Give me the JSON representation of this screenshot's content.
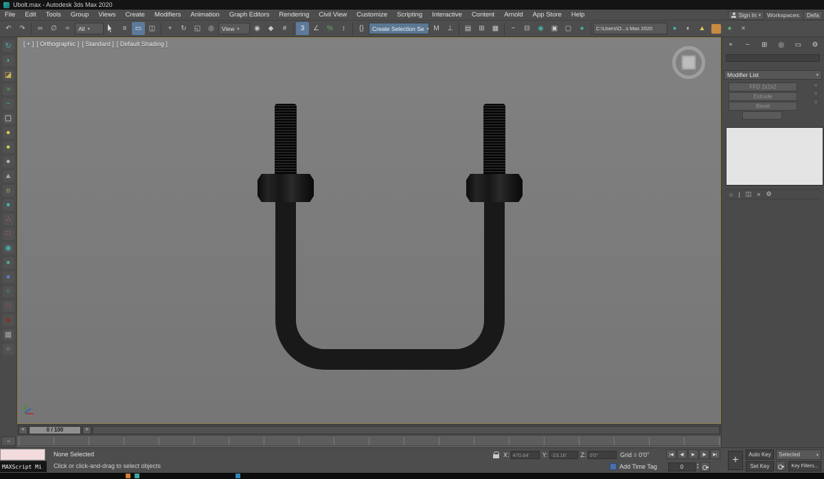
{
  "colors": {
    "accent_blue": "#5d7a9b",
    "panel_gray": "#4a4a4a",
    "viewport_bg": "#7c7c7c",
    "model_black": "#191919",
    "listener_pink": "#f2dadd",
    "viewport_border": "#8e7f44"
  },
  "titlebar": {
    "title": "Ubolt.max - Autodesk 3ds Max 2020"
  },
  "menubar": {
    "items": [
      "File",
      "Edit",
      "Tools",
      "Group",
      "Views",
      "Create",
      "Modifiers",
      "Animation",
      "Graph Editors",
      "Rendering",
      "Civil View",
      "Customize",
      "Scripting",
      "Interactive",
      "Content",
      "Arnold",
      "App Store",
      "Help"
    ]
  },
  "account": {
    "sign_in": "Sign In",
    "workspaces_label": "Workspaces:",
    "workspace_value": "Defa"
  },
  "toolbar": {
    "filter_dropdown": "All",
    "ref_coord_dropdown": "View",
    "selection_set_field": "Create Selection Se",
    "path_field": "C:\\Users\\O...s Max 2020"
  },
  "viewport": {
    "menu_plus": "[ + ]",
    "menu_pov": "[ Orthographic ]",
    "menu_standard": "[ Standard ]",
    "menu_shading": "[ Default Shading ]"
  },
  "timeline": {
    "thumb": "0 / 100",
    "prev": "<",
    "next": ">"
  },
  "command_panel": {
    "modifier_list_label": "Modifier List",
    "stack": [
      "FFD 2x2x2",
      "Extrude",
      "Bevel"
    ]
  },
  "statusbar": {
    "selection_status": "None Selected",
    "prompt": "Click or click-and-drag to select objects",
    "maxscript_label": "MAXScript Mi",
    "x_label": "X:",
    "x_value": "470.64'",
    "y_label": "Y:",
    "y_value": "-23.16'",
    "z_label": "Z:",
    "z_value": "0'0\"",
    "grid": "Grid = 0'0\"",
    "add_time_tag": "Add Time Tag",
    "auto_key": "Auto Key",
    "set_key": "Set Key",
    "key_filters": "Key Filters...",
    "key_mode_dropdown": "Selected",
    "frame_field": "0"
  },
  "icons": {
    "dropdown_arrow": "▾",
    "undo": "↶",
    "redo": "↷",
    "select_link": "∞",
    "unlink": "∅",
    "bind_spacewarp": "≈",
    "select_by_name": "≡",
    "selection_region": "▭",
    "window_crossing": "◫",
    "select_move": "+",
    "select_rotate": "↻",
    "select_scale": "◱",
    "select_placement": "◎",
    "use_pivot": "◉",
    "select_manipulate": "◆",
    "kbd_override": "#",
    "snap_toggle": "3",
    "angle_snap": "∠",
    "percent_snap": "%",
    "spinner_snap": "↕",
    "named_sets": "{}",
    "mirror": "M",
    "align": "⊥",
    "toggle_ribbon": "▤",
    "scene_explorer": "⊞",
    "layer_explorer": "▦",
    "curve_editor": "~",
    "schematic_view": "⊟",
    "material_editor": "◉",
    "render_setup": "▣",
    "rendered_frame": "▢",
    "render": "●",
    "teapot": "●",
    "half": "◐",
    "tri": "▲",
    "dot_green": "●",
    "close_x": "×",
    "mini_curve": "~",
    "transport_start": "|◀",
    "transport_prev": "◀|",
    "transport_play": "▶",
    "transport_next": "|▶",
    "transport_end": "▶|",
    "spin_up": "▴",
    "spin_down": "▾",
    "key_plus": "+",
    "cp_create": "+",
    "cp_modify": "~",
    "cp_hierarchy": "⊞",
    "cp_motion": "◎",
    "cp_display": "▭",
    "cp_utilities": "⚙",
    "stack_pin": "○",
    "stack_show_end": "|",
    "stack_unique": "◫",
    "stack_remove": "×",
    "stack_config": "⚙"
  },
  "left_toolbar": {
    "items": [
      {
        "name": "rotate-teal",
        "glyph": "↻",
        "color": "#45b0a6"
      },
      {
        "name": "crescent",
        "glyph": "◗",
        "color": "#45b0a6"
      },
      {
        "name": "swatch-dark",
        "glyph": "◪",
        "color": "#cdb44e"
      },
      {
        "name": "spray-green",
        "glyph": "≈",
        "color": "#67b06a"
      },
      {
        "name": "wave-teal",
        "glyph": "~",
        "color": "#45b0a6"
      },
      {
        "name": "card-white",
        "glyph": "▢",
        "color": "#e6e6e6"
      },
      {
        "name": "sphere-yellow",
        "glyph": "●",
        "color": "#d9c95c"
      },
      {
        "name": "sphere-olive",
        "glyph": "●",
        "color": "#c3cc5a"
      },
      {
        "name": "sphere-gray",
        "glyph": "●",
        "color": "#b8b8b8"
      },
      {
        "name": "cone-gray",
        "glyph": "▲",
        "color": "#a8a8a8"
      },
      {
        "name": "light-sun",
        "glyph": "☼",
        "color": "#e6d44e"
      },
      {
        "name": "sphere-teal",
        "glyph": "●",
        "color": "#45b0a6"
      },
      {
        "name": "dots-red",
        "glyph": "∴",
        "color": "#d97070"
      },
      {
        "name": "dots-pair",
        "glyph": "∷",
        "color": "#d97070"
      },
      {
        "name": "target-teal",
        "glyph": "◉",
        "color": "#45b0a6"
      },
      {
        "name": "sphere-seagreen",
        "glyph": "●",
        "color": "#58a68e"
      },
      {
        "name": "sphere-blue",
        "glyph": "●",
        "color": "#5b7fd4"
      },
      {
        "name": "ring-teal",
        "glyph": "○",
        "color": "#45b0a6"
      },
      {
        "name": "grid-dots-red",
        "glyph": "∷",
        "color": "#cc5a5a"
      },
      {
        "name": "swatch-darkred",
        "glyph": "■",
        "color": "#7e2f2f"
      },
      {
        "name": "box-gray",
        "glyph": "▦",
        "color": "#a5a5a5"
      },
      {
        "name": "circle-gray",
        "glyph": "○",
        "color": "#a5a5a5"
      }
    ]
  }
}
